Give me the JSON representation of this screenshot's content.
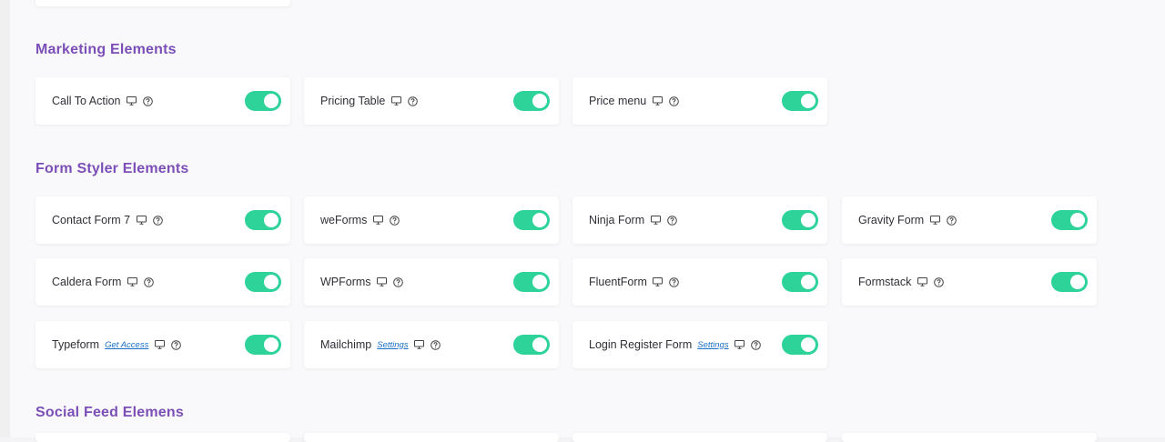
{
  "sections": {
    "marketing": {
      "title": "Marketing Elements",
      "items": [
        {
          "label": "Call To Action",
          "enabled": true
        },
        {
          "label": "Pricing Table",
          "enabled": true
        },
        {
          "label": "Price menu",
          "enabled": true
        }
      ]
    },
    "form_styler": {
      "title": "Form Styler Elements",
      "items": [
        {
          "label": "Contact Form 7",
          "enabled": true
        },
        {
          "label": "weForms",
          "enabled": true
        },
        {
          "label": "Ninja Form",
          "enabled": true
        },
        {
          "label": "Gravity Form",
          "enabled": true
        },
        {
          "label": "Caldera Form",
          "enabled": true
        },
        {
          "label": "WPForms",
          "enabled": true
        },
        {
          "label": "FluentForm",
          "enabled": true
        },
        {
          "label": "Formstack",
          "enabled": true
        },
        {
          "label": "Typeform",
          "link": "Get Access",
          "enabled": true
        },
        {
          "label": "Mailchimp",
          "link": "Settings",
          "enabled": true
        },
        {
          "label": "Login Register Form",
          "link": "Settings",
          "enabled": true
        }
      ]
    },
    "social_feed": {
      "title": "Social Feed Elemens"
    }
  },
  "icons": {
    "desktop": "desktop-icon",
    "help": "help-circle-icon"
  },
  "colors": {
    "accent": "#7b4fb7",
    "toggle_on": "#2ed39a",
    "link": "#1a6fc7"
  }
}
